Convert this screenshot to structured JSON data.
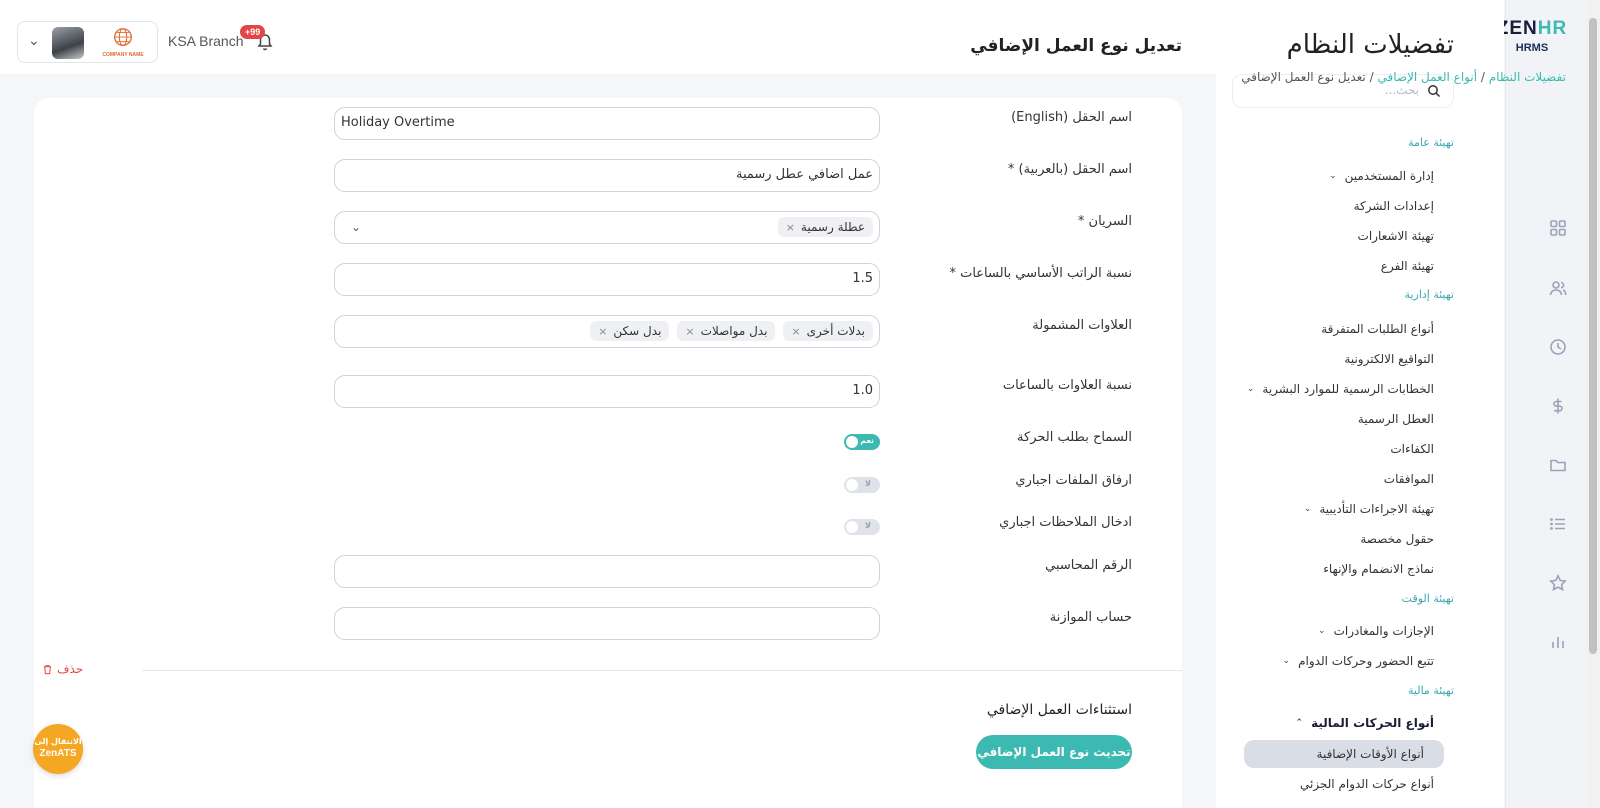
{
  "logo": {
    "brand_main": "ZEN",
    "brand_accent": "HR",
    "product": "HRMS"
  },
  "rail_icons": [
    "grid-icon",
    "users-icon",
    "clock-icon",
    "dollar-icon",
    "folder-icon",
    "list-icon",
    "star-icon",
    "bar-chart-icon"
  ],
  "settings": {
    "title": "تفضيلات النظام",
    "search_placeholder": "بحث...",
    "groups": {
      "general": "تهيئة عامة",
      "admin": "تهيئة إدارية",
      "time": "تهيئة الوقت",
      "finance": "تهيئة مالية"
    },
    "items": {
      "user_management": "إدارة المستخدمين",
      "company_settings": "إعدادات الشركة",
      "notifications": "تهيئة الاشعارات",
      "branch": "تهيئة الفرع",
      "misc_requests": "أنواع الطلبات المتفرقة",
      "e_signatures": "التواقيع الالكترونية",
      "hr_letters": "الخطابات الرسمية للموارد البشرية",
      "holidays": "العطل الرسمية",
      "competencies": "الكفاءات",
      "approvals": "الموافقات",
      "disciplinary": "تهيئة الاجراءات التأديبية",
      "custom_fields": "حقول مخصصة",
      "onboarding": "نماذج الانضمام والإنهاء",
      "leaves": "الإجازات والمغادرات",
      "attendance": "تتبع الحضور وحركات الدوام",
      "financial_types": "أنواع الحركات المالية",
      "overtime_types": "أنواع الأوقات الإضافية",
      "part_time": "أنواع حركات الدوام الجزئي"
    }
  },
  "header": {
    "page_title": "تعديل نوع العمل الإضافي",
    "breadcrumb": {
      "root": "تفضيلات النظام",
      "parent": "أنواع العمل الإضافي",
      "current": "تعديل نوع العمل الإضافي",
      "sep": "/"
    },
    "branch_name": "KSA Branch",
    "company_name": "COMPANY NAME",
    "notif_count": "+99"
  },
  "form": {
    "name_en": {
      "label": "اسم الحقل (English)",
      "value": "Holiday Overtime"
    },
    "name_ar": {
      "label": "اسم الحقل (بالعربية) *",
      "value": "عمل اضافي عطل رسمية"
    },
    "applies": {
      "label": "السريان *",
      "chips": [
        "عطلة رسمية"
      ]
    },
    "base_rate": {
      "label": "نسبة الراتب الأساسي بالساعات *",
      "value": "1.5"
    },
    "allowances": {
      "label": "العلاوات المشمولة",
      "chips": [
        "بدلات أخرى",
        "بدل مواصلات",
        "بدل سكن"
      ]
    },
    "allowance_rate": {
      "label": "نسبة العلاوات بالساعات",
      "value": "1.0"
    },
    "allow_request": {
      "label": "السماح بطلب الحركة",
      "state": "نعم"
    },
    "attach_required": {
      "label": "ارفاق الملفات اجباري",
      "state": "لا"
    },
    "notes_required": {
      "label": "ادخال الملاحظات اجباري",
      "state": "لا"
    },
    "accounting_no": {
      "label": "الرقم المحاسبي",
      "value": ""
    },
    "budget_account": {
      "label": "حساب الموازنة",
      "value": ""
    },
    "exceptions_title": "استثناءات العمل الإضافي",
    "update_button": "تحديث نوع العمل الإضافي",
    "delete_link": "حذف"
  },
  "ats": {
    "line1": "الانتقال إلى",
    "line2": "ZenATS"
  },
  "colors": {
    "accent": "#3cb9b0",
    "danger": "#e64545",
    "fab": "#f5a623"
  }
}
